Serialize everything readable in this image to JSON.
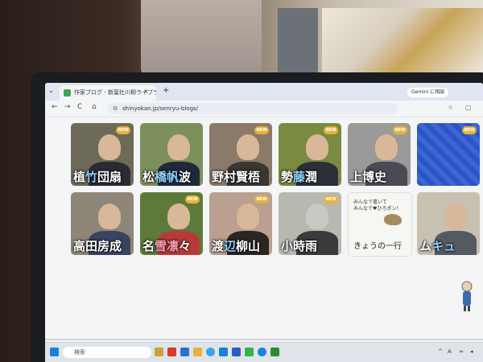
{
  "browser": {
    "tab_title": "作家ブログ - 新葉社川柳ライブラリ",
    "tab_close": "×",
    "new_tab": "+",
    "gemini_label": "Gemini に相談",
    "url": "shinyokan.jp/senryu-blogs/",
    "nav_back": "←",
    "nav_forward": "→",
    "nav_reload": "C",
    "nav_home": "⌂"
  },
  "badge_text": "NEW",
  "cards_row1": [
    {
      "name_pre": "植",
      "name_hl": "竹",
      "name_post": "団扇",
      "new": true,
      "bg": "#6e6a58",
      "body": "#2b2b33"
    },
    {
      "name_pre": "松",
      "name_hl": "橋帆",
      "name_post": "波",
      "new": false,
      "bg": "#7d8f5a",
      "body": "#1f2a3a"
    },
    {
      "name_pre": "野",
      "name_hl": "",
      "name_post": "村賢梧",
      "new": true,
      "bg": "#8a7a6a",
      "body": "#3a3630"
    },
    {
      "name_pre": "勢",
      "name_hl": "藤",
      "name_post": "潤",
      "new": true,
      "bg": "#7a8a40",
      "body": "#2a2f3a"
    },
    {
      "name_pre": "上",
      "name_hl": "",
      "name_post": "博史",
      "new": true,
      "bg": "#9a9a98",
      "body": "#4a4a55"
    },
    {
      "name_pre": "",
      "name_hl": "",
      "name_post": "",
      "new": true,
      "bg": "#2b55c4",
      "body": "#2b55c4"
    }
  ],
  "cards_row2": [
    {
      "name_pre": "高",
      "name_hl": "",
      "name_post": "田房成",
      "new": false,
      "bg": "#8e8678",
      "body": "#3a4260"
    },
    {
      "name_pre": "名",
      "name_hl2": "雪凛",
      "name_post": "々",
      "new": true,
      "bg": "#5e7a3a",
      "body": "#b73a3a"
    },
    {
      "name_pre": "渡",
      "name_hl": "辺",
      "name_post": "柳山",
      "new": true,
      "bg": "#b9a090",
      "body": "#2a2622"
    },
    {
      "name_pre": "小",
      "name_hl": "",
      "name_post": "時雨",
      "new": true,
      "bg": "#b8b8b0",
      "body": "#3a3a3a",
      "gray": true
    },
    {
      "name_pre": "",
      "name_hl": "",
      "name_post": "",
      "new": false,
      "bg": "#f6f6f2",
      "body": "#f6f6f2",
      "promo": true
    },
    {
      "name_pre": "ム",
      "name_hl": "キュ",
      "name_post": "",
      "new": false,
      "bg": "#c8c0b0",
      "body": "#555a60"
    }
  ],
  "promo": {
    "line1": "みんなで書いて",
    "line2": "みんなで♥ひろポン！",
    "title": "きょうの一行"
  },
  "taskbar": {
    "search_label": "検索",
    "tray_lang": "A"
  },
  "colors": {
    "accent_new": "#e7b33a",
    "browser_bg": "#f4f5f7"
  }
}
